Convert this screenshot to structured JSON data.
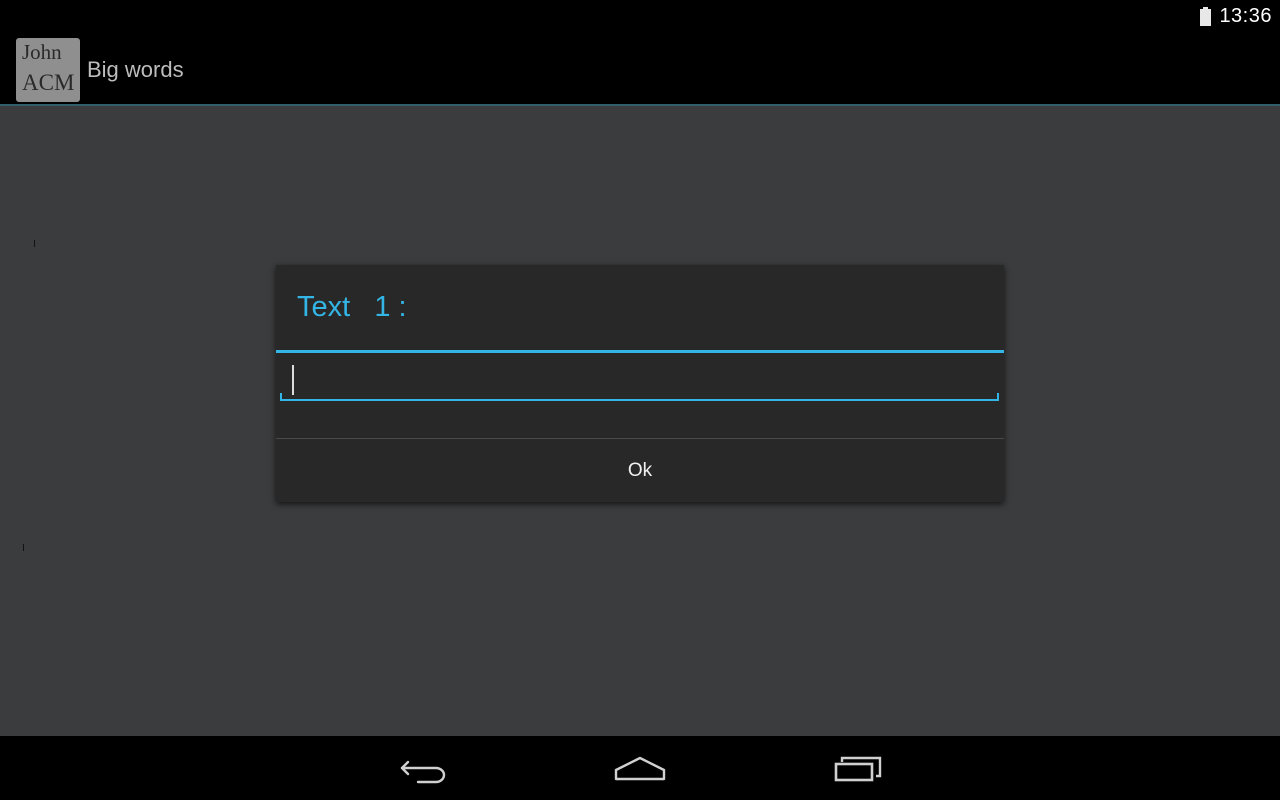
{
  "status_bar": {
    "time": "13:36",
    "battery_icon": "battery-full-icon"
  },
  "action_bar": {
    "app_icon_line1": "John",
    "app_icon_line2": "ACM",
    "title": "Big words"
  },
  "dialog": {
    "title": "Text   1 :",
    "input_value": "",
    "ok_label": "Ok"
  },
  "nav_bar": {
    "icons": [
      "back-icon",
      "home-icon",
      "recent-apps-icon"
    ]
  },
  "colors": {
    "accent": "#33b5e5",
    "background": "#3b3c3d",
    "dialog_background": "#282828"
  }
}
